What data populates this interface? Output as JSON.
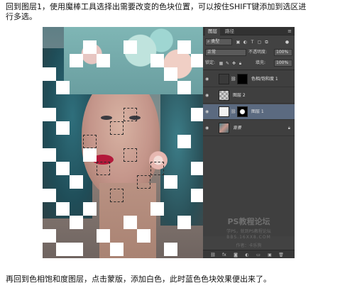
{
  "captions": {
    "top": "回到图层1，使用魔棒工具选择出需要改变的色块位置，可以按住SHIFT键添加到选区进行多选。",
    "bottom": "再回到色相饱和度图层，点击蒙版，添加白色，此时蓝色色块效果便出来了。"
  },
  "panel": {
    "tabs": [
      "图层",
      "路径"
    ],
    "menu_glyph": "≡",
    "filter": {
      "label": "类型"
    },
    "blend": {
      "mode": "正常",
      "opacity_label": "不透明度:",
      "opacity": "100%"
    },
    "lock": {
      "label": "锁定:",
      "fill_label": "填充:",
      "fill": "100%"
    },
    "layers": [
      {
        "name": "色相/饱和度 1",
        "selected": false
      },
      {
        "name": "图层 2",
        "selected": false
      },
      {
        "name": "图层 1",
        "selected": true
      },
      {
        "name": "背景",
        "selected": false,
        "locked": true
      }
    ],
    "watermark": {
      "title": "PS教程论坛",
      "sub": "学PS，就到PS教程论坛",
      "url": "BBS.16XX8.COM",
      "author": "作者：卡乐狗"
    },
    "bottom_icons": [
      "link-icon",
      "fx-icon",
      "mask-icon",
      "adjustment-icon",
      "folder-icon",
      "new-layer-icon",
      "trash-icon"
    ]
  },
  "colors": {
    "panel_bg": "#424242",
    "selected_layer": "#5b6a80"
  }
}
